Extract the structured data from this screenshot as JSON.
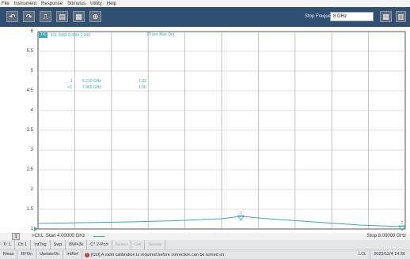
{
  "menu": [
    "File",
    "Instrument",
    "Response",
    "Stimulus",
    "Utility",
    "Help"
  ],
  "toolbar": {
    "stop_label": "Stop Frequency",
    "stop_value": "8 GHz"
  },
  "trace": {
    "number": "Tr1",
    "label": "S11 SWR 0.500/ 1.000",
    "mode": "[Trace Max On]"
  },
  "y_ticks": [
    "6",
    "5.5",
    "5",
    "4.5",
    "4",
    "3.5",
    "3",
    "2.5",
    "2",
    "1.5",
    "1"
  ],
  "markers": [
    {
      "num": "1",
      "freq": "6.210 GHz",
      "value": "1.32"
    },
    {
      "num": ">2",
      "freq": "7.965 GHz",
      "value": "1.06"
    }
  ],
  "chart_data": {
    "type": "line",
    "title": "",
    "xlabel": "",
    "ylabel": "",
    "xlim": [
      4.0,
      8.0
    ],
    "ylim": [
      1,
      6
    ],
    "series": [
      {
        "x": [
          4.0,
          4.5,
          5.0,
          5.5,
          6.0,
          6.21,
          6.5,
          7.0,
          7.5,
          7.965,
          8.0
        ],
        "values": [
          1.14,
          1.16,
          1.18,
          1.21,
          1.26,
          1.32,
          1.26,
          1.18,
          1.1,
          1.06,
          1.08
        ]
      }
    ],
    "grid": true
  },
  "status": {
    "channel": "1",
    "start": ">Ch1: Start  4.00000 GHz",
    "stop": "Stop  8.00000 GHz"
  },
  "tabs": [
    "Tr 1",
    "Ch 1",
    "IntTrig",
    "Swp",
    "BW=2k",
    "C* 2-Port",
    "Select",
    "Del",
    "Sweep"
  ],
  "bottom": {
    "items": [
      "Meas",
      "RFOn",
      "UpdateOn",
      "IntRef"
    ],
    "message": "[Ctrl] A valid calibration is required before correction can be turned on",
    "right": [
      "LCL",
      "2023/12/4 14:36"
    ]
  }
}
